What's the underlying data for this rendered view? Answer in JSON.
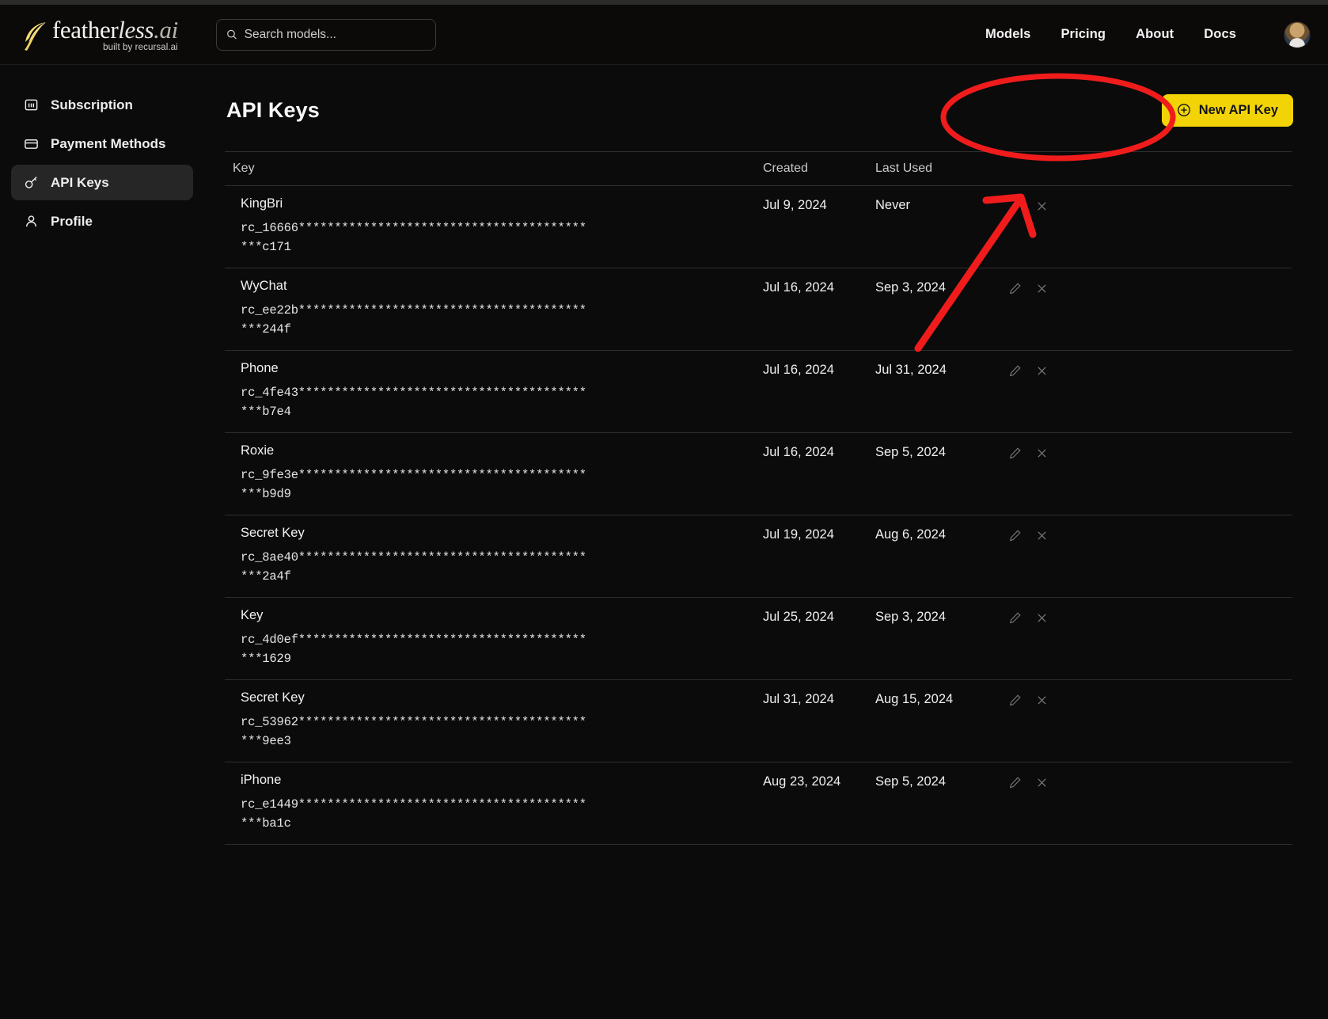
{
  "header": {
    "logo": {
      "main_bold": "feather",
      "main_italic": "less",
      "main_suffix": ".ai",
      "tagline": "built by recursal.ai"
    },
    "search": {
      "placeholder": "Search models...",
      "value": "",
      "icon": "search-icon"
    },
    "nav": [
      {
        "label": "Models"
      },
      {
        "label": "Pricing"
      },
      {
        "label": "About"
      },
      {
        "label": "Docs"
      }
    ],
    "avatar_alt": "user-avatar"
  },
  "sidebar": {
    "items": [
      {
        "label": "Subscription",
        "icon": "subscription-icon",
        "active": false
      },
      {
        "label": "Payment Methods",
        "icon": "credit-card-icon",
        "active": false
      },
      {
        "label": "API Keys",
        "icon": "key-icon",
        "active": true
      },
      {
        "label": "Profile",
        "icon": "person-icon",
        "active": false
      }
    ]
  },
  "main": {
    "title": "API Keys",
    "new_key_button": {
      "label": "New API Key",
      "icon": "plus-circle-icon",
      "color": "#f2d406"
    },
    "table": {
      "columns": {
        "key": "Key",
        "created": "Created",
        "last_used": "Last Used"
      },
      "row_actions": {
        "edit": "pencil-icon",
        "delete": "close-icon"
      },
      "rows": [
        {
          "name": "KingBri",
          "secret": "rc_16666*******************************************c171",
          "created": "Jul 9, 2024",
          "last_used": "Never"
        },
        {
          "name": "WyChat",
          "secret": "rc_ee22b*******************************************244f",
          "created": "Jul 16, 2024",
          "last_used": "Sep 3, 2024"
        },
        {
          "name": "Phone",
          "secret": "rc_4fe43*******************************************b7e4",
          "created": "Jul 16, 2024",
          "last_used": "Jul 31, 2024"
        },
        {
          "name": "Roxie",
          "secret": "rc_9fe3e*******************************************b9d9",
          "created": "Jul 16, 2024",
          "last_used": "Sep 5, 2024"
        },
        {
          "name": "Secret Key",
          "secret": "rc_8ae40*******************************************2a4f",
          "created": "Jul 19, 2024",
          "last_used": "Aug 6, 2024"
        },
        {
          "name": "Key",
          "secret": "rc_4d0ef*******************************************1629",
          "created": "Jul 25, 2024",
          "last_used": "Sep 3, 2024"
        },
        {
          "name": "Secret Key",
          "secret": "rc_53962*******************************************9ee3",
          "created": "Jul 31, 2024",
          "last_used": "Aug 15, 2024"
        },
        {
          "name": "iPhone",
          "secret": "rc_e1449*******************************************ba1c",
          "created": "Aug 23, 2024",
          "last_used": "Sep 5, 2024"
        }
      ]
    }
  },
  "annotations": {
    "color": "#f01c1c",
    "ellipse_target": "new-api-key-button",
    "arrow_target": "new-api-key-button"
  }
}
